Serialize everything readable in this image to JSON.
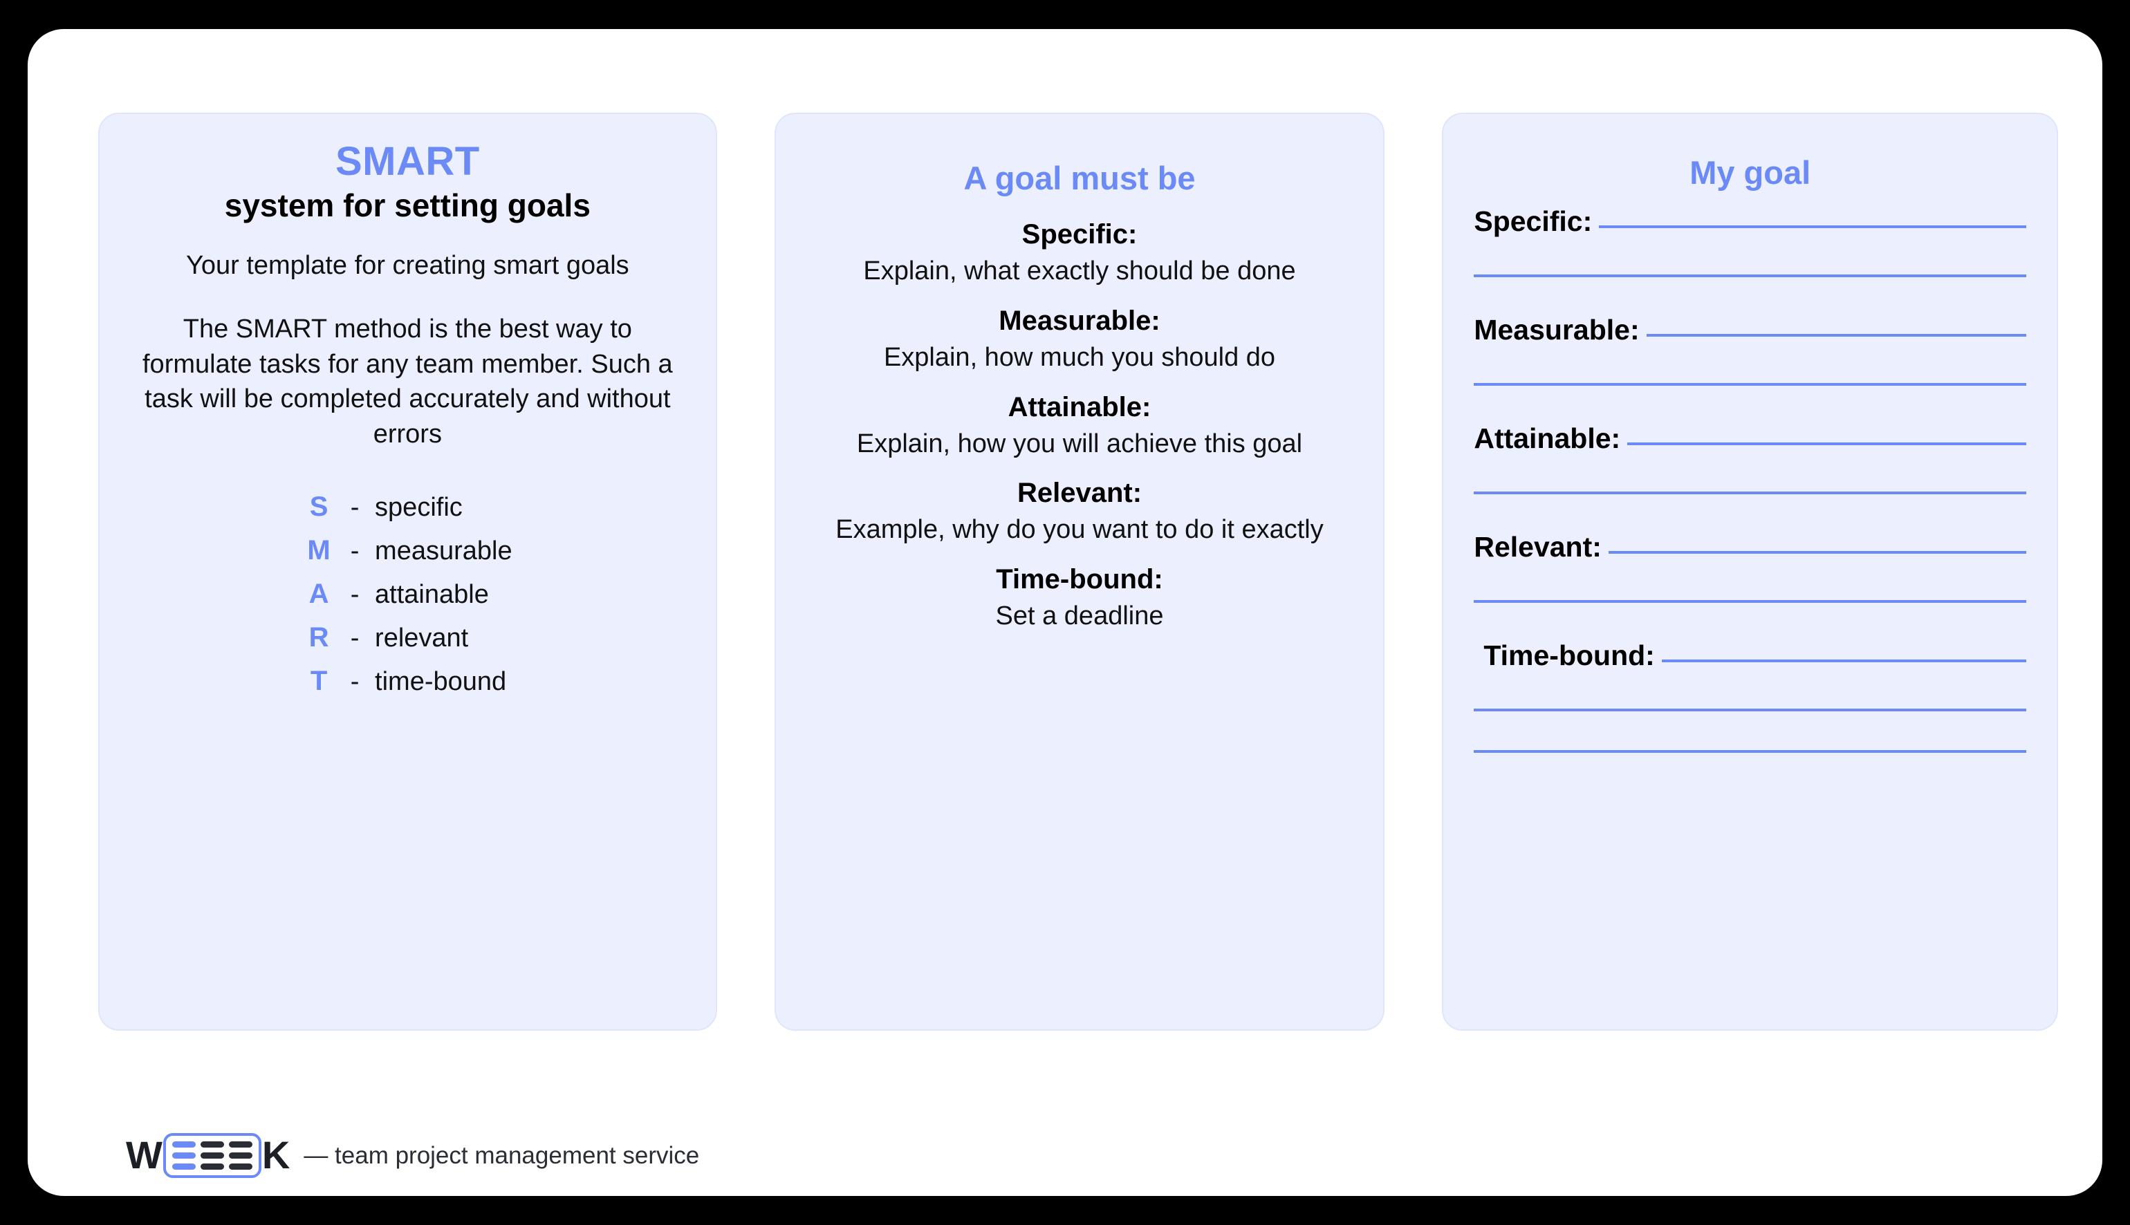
{
  "colors": {
    "accent_blue": "#6b8af5",
    "card_bg": "#ecf0fe",
    "card_border": "#dfe6fb",
    "page_bg": "#ffffff",
    "canvas_bg": "#000000",
    "text_dark": "#111111",
    "logo_dark": "#2b2d35"
  },
  "card_intro": {
    "title": "SMART",
    "subtitle": "system for setting goals",
    "paragraph_1": "Your template for creating smart goals",
    "paragraph_2": "The SMART method is the best way to formulate tasks for any team member. Such a task will be completed accurately and without errors",
    "acronym": [
      {
        "letter": "S",
        "dash": "-",
        "word": "specific"
      },
      {
        "letter": "M",
        "dash": "-",
        "word": "measurable"
      },
      {
        "letter": "A",
        "dash": "-",
        "word": "attainable"
      },
      {
        "letter": "R",
        "dash": "-",
        "word": "relevant"
      },
      {
        "letter": "T",
        "dash": "-",
        "word": "time-bound"
      }
    ]
  },
  "card_criteria": {
    "title": "A goal must be",
    "items": [
      {
        "term": "Specific:",
        "definition": "Explain, what exactly should be done"
      },
      {
        "term": "Measurable:",
        "definition": "Explain, how much you should do"
      },
      {
        "term": "Attainable:",
        "definition": "Explain, how you will achieve this goal"
      },
      {
        "term": "Relevant:",
        "definition": "Example, why do you want to do it exactly"
      },
      {
        "term": "Time-bound:",
        "definition": "Set a deadline"
      }
    ]
  },
  "card_worksheet": {
    "title": "My goal",
    "fields": [
      {
        "label": "Specific:",
        "value": "",
        "extra_blank_lines": 1
      },
      {
        "label": "Measurable:",
        "value": "",
        "extra_blank_lines": 1
      },
      {
        "label": "Attainable:",
        "value": "",
        "extra_blank_lines": 1
      },
      {
        "label": "Relevant:",
        "value": "",
        "extra_blank_lines": 1
      },
      {
        "label": "Time-bound:",
        "value": "",
        "extra_blank_lines": 2
      }
    ]
  },
  "footer": {
    "logo_left": "W",
    "logo_right": "K",
    "logo_name": "WEEEK",
    "tagline": "— team project management service"
  }
}
